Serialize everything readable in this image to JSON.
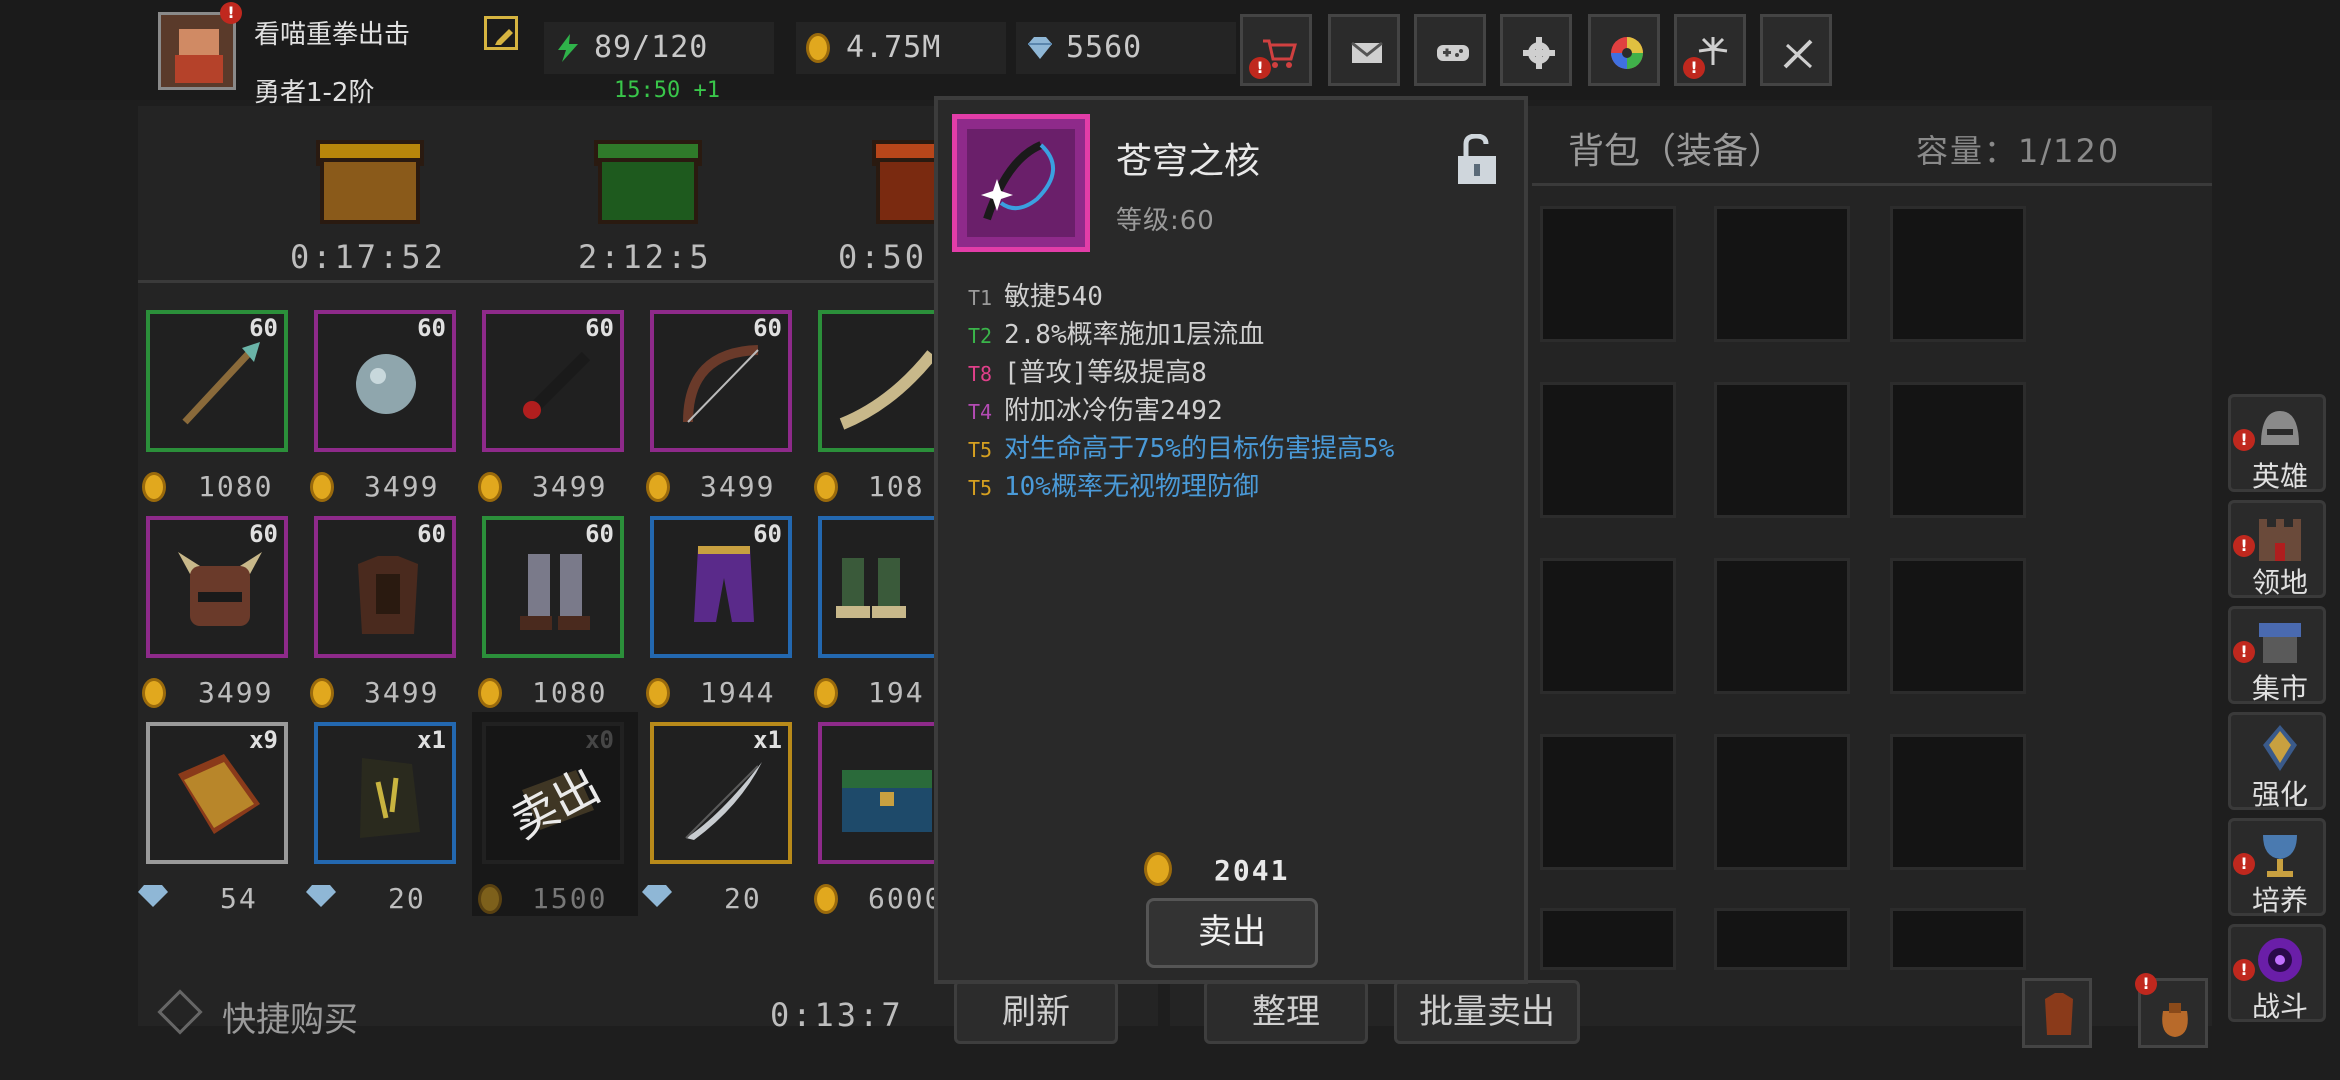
{
  "player": {
    "name": "看喵重拳出击",
    "rank": "勇者1-2阶"
  },
  "resources": {
    "stamina": "89/120",
    "stamina_timer": "15:50 +1",
    "gold": "4.75M",
    "gems": "5560"
  },
  "toolbar": {
    "icons": [
      "shop-cart-icon",
      "mail-icon",
      "gamepad-icon",
      "settings-gear-icon",
      "color-wheel-icon",
      "fireworks-icon",
      "sword-cancel-icon"
    ]
  },
  "shop": {
    "chests": [
      {
        "timer": "0:17:52",
        "color": "#b8860b"
      },
      {
        "timer": "2:12:5",
        "color": "#2f7a2a"
      },
      {
        "timer": "0:50",
        "color": "#b8461a"
      }
    ],
    "rows": [
      [
        {
          "name": "spear",
          "level": "60",
          "price": "1080",
          "currency": "gold",
          "rarity": "#2b8f3a"
        },
        {
          "name": "orb",
          "level": "60",
          "price": "3499",
          "currency": "gold",
          "rarity": "#8e2a8a"
        },
        {
          "name": "dagger",
          "level": "60",
          "price": "3499",
          "currency": "gold",
          "rarity": "#8e2a8a"
        },
        {
          "name": "bow",
          "level": "60",
          "price": "3499",
          "currency": "gold",
          "rarity": "#8e2a8a"
        },
        {
          "name": "scythe",
          "level": "",
          "price": "108",
          "currency": "gold",
          "rarity": "#2b8f3a"
        }
      ],
      [
        {
          "name": "helmet",
          "level": "60",
          "price": "3499",
          "currency": "gold",
          "rarity": "#8e2a8a"
        },
        {
          "name": "armor",
          "level": "60",
          "price": "3499",
          "currency": "gold",
          "rarity": "#8e2a8a"
        },
        {
          "name": "greaves",
          "level": "60",
          "price": "1080",
          "currency": "gold",
          "rarity": "#2b8f3a"
        },
        {
          "name": "pants",
          "level": "60",
          "price": "1944",
          "currency": "gold",
          "rarity": "#2368b0"
        },
        {
          "name": "boots",
          "level": "",
          "price": "194",
          "currency": "gold",
          "rarity": "#2368b0"
        }
      ],
      [
        {
          "name": "book",
          "count": "x9",
          "price": "54",
          "currency": "gem",
          "rarity": "#9a9a9a"
        },
        {
          "name": "rune-stone",
          "count": "x1",
          "price": "20",
          "currency": "gem",
          "rarity": "#2368b0"
        },
        {
          "name": "scroll",
          "count": "x0",
          "price": "1500",
          "currency": "gold",
          "rarity": "#333333",
          "sold": "卖出"
        },
        {
          "name": "feather",
          "count": "x1",
          "price": "20",
          "currency": "gem",
          "rarity": "#b88a1a"
        },
        {
          "name": "treasure-chest",
          "count": "",
          "price": "6000",
          "currency": "gold",
          "rarity": "#8e2a8a"
        }
      ]
    ],
    "quick_buy": "快捷购买",
    "refresh_timer": "0:13:7",
    "refresh_label": "刷新"
  },
  "bag": {
    "title": "背包（装备）",
    "capacity": "容量：1/120",
    "sort_label": "整理",
    "bulk_sell_label": "批量卖出"
  },
  "side_nav": [
    {
      "label": "英雄",
      "icon": "hero-helmet-icon"
    },
    {
      "label": "领地",
      "icon": "territory-castle-icon"
    },
    {
      "label": "集市",
      "icon": "market-stall-icon"
    },
    {
      "label": "强化",
      "icon": "enhance-crystal-icon"
    },
    {
      "label": "培养",
      "icon": "cultivate-chalice-icon"
    },
    {
      "label": "战斗",
      "icon": "battle-portal-icon"
    }
  ],
  "item_detail": {
    "name": "苍穹之核",
    "level": "等级:60",
    "attributes": [
      {
        "tier": "T1",
        "text": "敏捷540",
        "tier_color": "#9a9a9a",
        "text_color": "#d0d0d0"
      },
      {
        "tier": "T2",
        "text": "2.8%概率施加1层流血",
        "tier_color": "#3ab54a",
        "text_color": "#d0d0d0"
      },
      {
        "tier": "T8",
        "text": "[普攻]等级提高8",
        "tier_color": "#e0408a",
        "text_color": "#d0d0d0"
      },
      {
        "tier": "T4",
        "text": "附加冰冷伤害2492",
        "tier_color": "#b44bb4",
        "text_color": "#d0d0d0"
      },
      {
        "tier": "T5",
        "text": "对生命高于75%的目标伤害提高5%",
        "tier_color": "#d6a020",
        "text_color": "#4a9ad8"
      },
      {
        "tier": "T5",
        "text": "10%概率无视物理防御",
        "tier_color": "#d6a020",
        "text_color": "#4a9ad8"
      }
    ],
    "price": "2041",
    "sell_label": "卖出"
  }
}
